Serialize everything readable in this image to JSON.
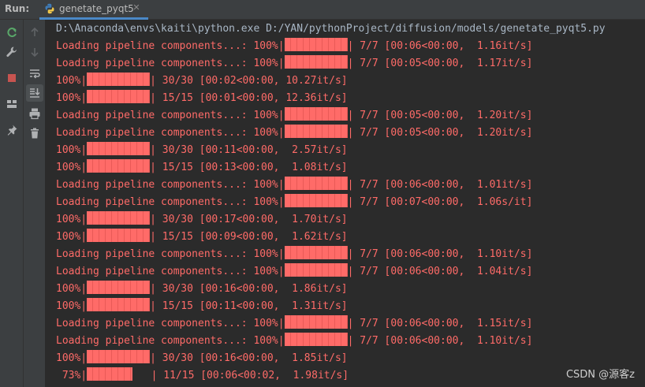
{
  "header": {
    "run_label": "Run:",
    "tab_title": "genetate_pyqt5"
  },
  "console": {
    "command": "D:\\Anaconda\\envs\\kaiti\\python.exe D:/YAN/pythonProject/diffusion/models/genetate_pyqt5.py",
    "lines": [
      {
        "prefix": "Loading pipeline components...: 100%|",
        "progress": 1.0,
        "suffix": "| 7/7 [00:06<00:00,  1.16it/s]"
      },
      {
        "prefix": "Loading pipeline components...: 100%|",
        "progress": 1.0,
        "suffix": "| 7/7 [00:05<00:00,  1.17it/s]"
      },
      {
        "prefix": "100%|",
        "progress": 1.0,
        "suffix": "| 30/30 [00:02<00:00, 10.27it/s]"
      },
      {
        "prefix": "100%|",
        "progress": 1.0,
        "suffix": "| 15/15 [00:01<00:00, 12.36it/s]"
      },
      {
        "prefix": "Loading pipeline components...: 100%|",
        "progress": 1.0,
        "suffix": "| 7/7 [00:05<00:00,  1.20it/s]"
      },
      {
        "prefix": "Loading pipeline components...: 100%|",
        "progress": 1.0,
        "suffix": "| 7/7 [00:05<00:00,  1.20it/s]"
      },
      {
        "prefix": "100%|",
        "progress": 1.0,
        "suffix": "| 30/30 [00:11<00:00,  2.57it/s]"
      },
      {
        "prefix": "100%|",
        "progress": 1.0,
        "suffix": "| 15/15 [00:13<00:00,  1.08it/s]"
      },
      {
        "prefix": "Loading pipeline components...: 100%|",
        "progress": 1.0,
        "suffix": "| 7/7 [00:06<00:00,  1.01it/s]"
      },
      {
        "prefix": "Loading pipeline components...: 100%|",
        "progress": 1.0,
        "suffix": "| 7/7 [00:07<00:00,  1.06s/it]"
      },
      {
        "prefix": "100%|",
        "progress": 1.0,
        "suffix": "| 30/30 [00:17<00:00,  1.70it/s]"
      },
      {
        "prefix": "100%|",
        "progress": 1.0,
        "suffix": "| 15/15 [00:09<00:00,  1.62it/s]"
      },
      {
        "prefix": "Loading pipeline components...: 100%|",
        "progress": 1.0,
        "suffix": "| 7/7 [00:06<00:00,  1.10it/s]"
      },
      {
        "prefix": "Loading pipeline components...: 100%|",
        "progress": 1.0,
        "suffix": "| 7/7 [00:06<00:00,  1.04it/s]"
      },
      {
        "prefix": "100%|",
        "progress": 1.0,
        "suffix": "| 30/30 [00:16<00:00,  1.86it/s]"
      },
      {
        "prefix": "100%|",
        "progress": 1.0,
        "suffix": "| 15/15 [00:11<00:00,  1.31it/s]"
      },
      {
        "prefix": "Loading pipeline components...: 100%|",
        "progress": 1.0,
        "suffix": "| 7/7 [00:06<00:00,  1.15it/s]"
      },
      {
        "prefix": "Loading pipeline components...: 100%|",
        "progress": 1.0,
        "suffix": "| 7/7 [00:06<00:00,  1.10it/s]"
      },
      {
        "prefix": "100%|",
        "progress": 1.0,
        "suffix": "| 30/30 [00:16<00:00,  1.85it/s]"
      },
      {
        "prefix": " 73%|",
        "progress": 0.73,
        "suffix": "   | 11/15 [00:06<00:02,  1.98it/s]"
      }
    ]
  },
  "watermark": "CSDN @源客z",
  "icons": {
    "tab": "python-file-icon",
    "close": "close-icon",
    "toolbar1": [
      "rerun-icon",
      "wrench-icon",
      "stop-icon",
      "layout-icon",
      "pin-icon"
    ],
    "toolbar2": [
      "arrow-up-icon",
      "arrow-down-icon",
      "soft-wrap-icon",
      "scroll-to-end-icon",
      "print-icon",
      "trash-icon"
    ]
  },
  "colors": {
    "background": "#2b2b2b",
    "panel": "#3c3f41",
    "stderr_text": "#ff6b68",
    "stdout_text": "#a9b7c6",
    "rerun_green": "#59a869",
    "stop_red": "#c75450",
    "tab_underline": "#4a88c7"
  }
}
